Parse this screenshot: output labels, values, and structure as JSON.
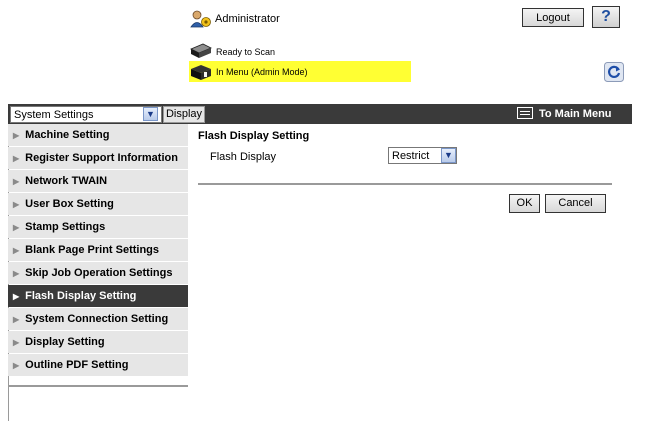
{
  "header": {
    "user_label": "Administrator",
    "logout_label": "Logout",
    "help_label": "?",
    "status_ready": "Ready to Scan",
    "status_menu": "In Menu (Admin Mode)",
    "status_highlight_color": "#ffff33"
  },
  "toolbar": {
    "category_select": "System Settings",
    "display_button": "Display",
    "main_menu_label": "To Main Menu"
  },
  "sidebar": {
    "items": [
      {
        "label": "Machine Setting",
        "active": false
      },
      {
        "label": "Register Support Information",
        "active": false
      },
      {
        "label": "Network TWAIN",
        "active": false
      },
      {
        "label": "User Box Setting",
        "active": false
      },
      {
        "label": "Stamp Settings",
        "active": false
      },
      {
        "label": "Blank Page Print Settings",
        "active": false
      },
      {
        "label": "Skip Job Operation Settings",
        "active": false
      },
      {
        "label": "Flash Display Setting",
        "active": true
      },
      {
        "label": "System Connection Setting",
        "active": false
      },
      {
        "label": "Display Setting",
        "active": false
      },
      {
        "label": "Outline PDF Setting",
        "active": false
      }
    ]
  },
  "main": {
    "title": "Flash Display Setting",
    "field_label": "Flash Display",
    "field_value": "Restrict",
    "ok_label": "OK",
    "cancel_label": "Cancel"
  },
  "colors": {
    "dark_bar": "#3a3a3a",
    "sidebar_bg": "#e6e6e6"
  }
}
